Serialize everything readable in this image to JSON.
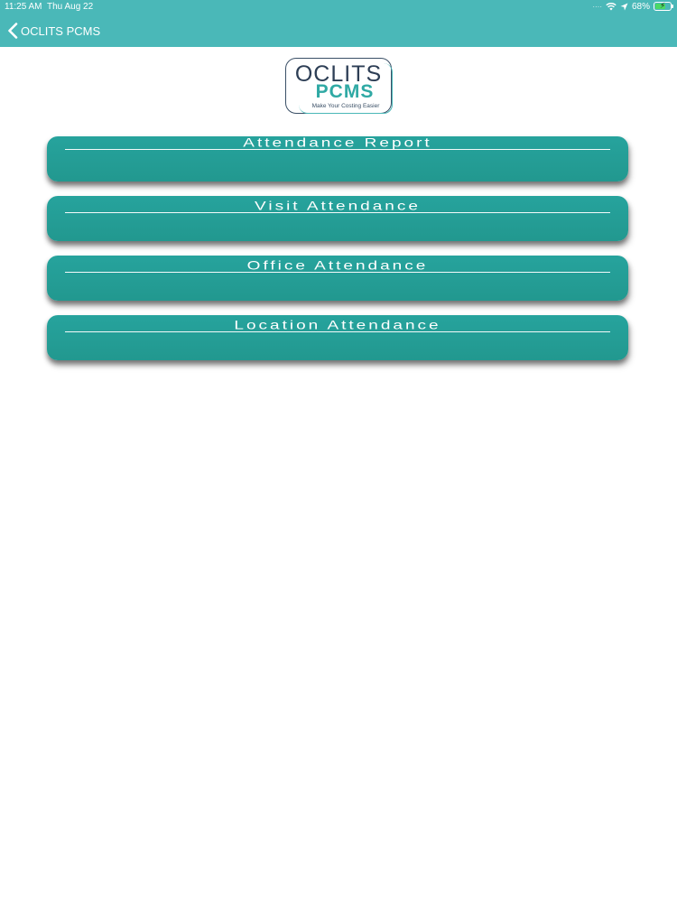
{
  "status_bar": {
    "time": "11:25 AM",
    "date": "Thu Aug 22",
    "battery": "68%",
    "battery_level": 0.68
  },
  "nav": {
    "back_label": "OCLITS PCMS"
  },
  "logo": {
    "line1": "OCLITS",
    "line2": "PCMS",
    "tagline": "Make Your Costing Easier"
  },
  "menu": [
    {
      "label": "Attendance Report"
    },
    {
      "label": "Visit Attendance"
    },
    {
      "label": "Office Attendance"
    },
    {
      "label": "Location Attendance"
    }
  ],
  "colors": {
    "header": "#4ab8b8",
    "button": "#26a39d",
    "logo_dark": "#2d3e55",
    "logo_teal": "#2fa9a4"
  },
  "icons": {
    "back": "chevron-left-icon",
    "wifi": "wifi-icon",
    "location": "location-arrow-icon",
    "battery": "battery-charging-icon"
  }
}
